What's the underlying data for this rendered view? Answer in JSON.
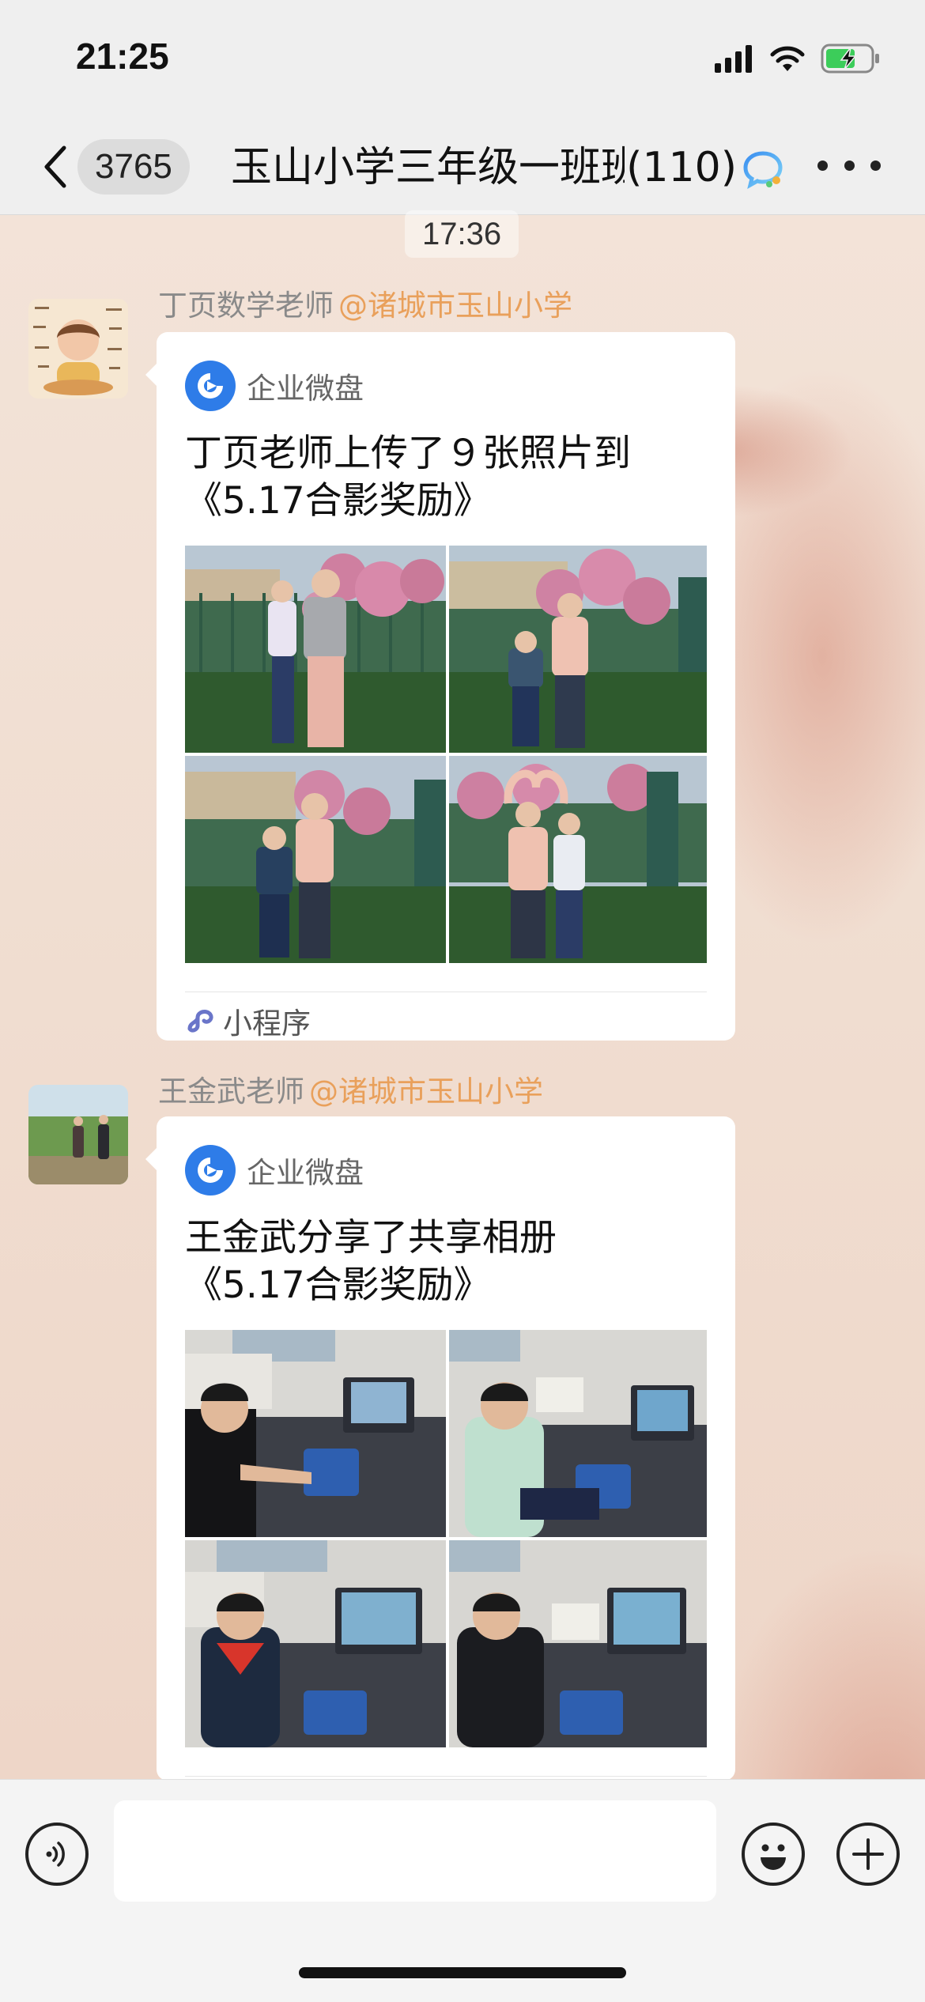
{
  "status_bar": {
    "time": "21:25"
  },
  "nav": {
    "unread_count": "3765",
    "title": "玉山小学三年级一班班",
    "member_count": "(110)"
  },
  "chat": {
    "timestamp": "17:36",
    "messages": [
      {
        "sender_name": "丁页数学老师",
        "sender_org": "@诸城市玉山小学",
        "app_name": "企业微盘",
        "title_line1": "丁页老师上传了９张照片到",
        "title_line2": "《5.17合影奖励》",
        "footer_label": "小程序"
      },
      {
        "sender_name": "王金武老师",
        "sender_org": "@诸城市玉山小学",
        "app_name": "企业微盘",
        "title_line1": "王金武分享了共享相册",
        "title_line2": "《5.17合影奖励》"
      }
    ]
  },
  "input": {
    "placeholder": ""
  },
  "icons": {
    "back": "chevron-left-icon",
    "title_badge": "chat-bubble-icon",
    "more": "more-dots-icon",
    "voice": "voice-icon",
    "emoji": "emoji-icon",
    "plus": "plus-icon",
    "app": "wedrive-logo-icon",
    "mini_program": "mini-program-icon"
  },
  "colors": {
    "org_accent": "#e9a05b",
    "app_blue": "#2e7ce8",
    "battery_green": "#3ccd5a"
  }
}
